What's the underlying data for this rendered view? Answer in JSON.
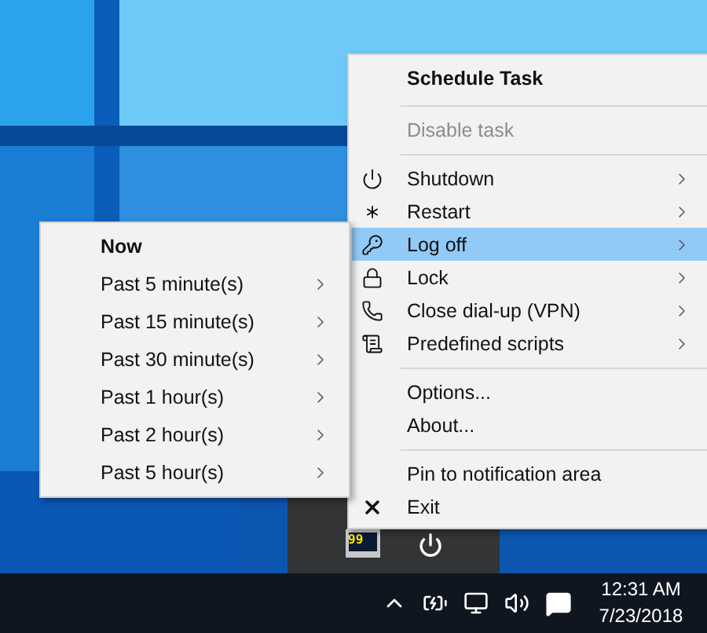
{
  "main_menu": {
    "items": [
      {
        "kind": "title",
        "label": "Schedule Task",
        "selected": false,
        "disabled": false,
        "submenu": false
      },
      {
        "kind": "separator"
      },
      {
        "kind": "item",
        "label": "Disable task",
        "selected": false,
        "disabled": true,
        "submenu": false
      },
      {
        "kind": "separator"
      },
      {
        "kind": "item",
        "label": "Shutdown",
        "selected": false,
        "disabled": false,
        "submenu": true
      },
      {
        "kind": "item",
        "label": "Restart",
        "selected": false,
        "disabled": false,
        "submenu": true
      },
      {
        "kind": "item",
        "label": "Log off",
        "selected": true,
        "disabled": false,
        "submenu": true
      },
      {
        "kind": "item",
        "label": "Lock",
        "selected": false,
        "disabled": false,
        "submenu": true
      },
      {
        "kind": "item",
        "label": "Close dial-up (VPN)",
        "selected": false,
        "disabled": false,
        "submenu": true
      },
      {
        "kind": "item",
        "label": "Predefined scripts",
        "selected": false,
        "disabled": false,
        "submenu": true
      },
      {
        "kind": "separator"
      },
      {
        "kind": "item",
        "label": "Options...",
        "selected": false,
        "disabled": false,
        "submenu": false
      },
      {
        "kind": "item",
        "label": "About...",
        "selected": false,
        "disabled": false,
        "submenu": false
      },
      {
        "kind": "separator"
      },
      {
        "kind": "item",
        "label": "Pin to notification area",
        "selected": false,
        "disabled": false,
        "submenu": false
      },
      {
        "kind": "item",
        "label": "Exit",
        "selected": false,
        "disabled": false,
        "submenu": false
      }
    ]
  },
  "submenu": {
    "items": [
      {
        "kind": "title",
        "label": "Now",
        "selected": false,
        "submenu": false
      },
      {
        "kind": "item",
        "label": "Past 5 minute(s)",
        "selected": false,
        "submenu": true
      },
      {
        "kind": "item",
        "label": "Past 15 minute(s)",
        "selected": false,
        "submenu": true
      },
      {
        "kind": "item",
        "label": "Past 30 minute(s)",
        "selected": false,
        "submenu": true
      },
      {
        "kind": "item",
        "label": "Past 1 hour(s)",
        "selected": false,
        "submenu": true
      },
      {
        "kind": "item",
        "label": "Past 2 hour(s)",
        "selected": false,
        "submenu": true
      },
      {
        "kind": "item",
        "label": "Past 5 hour(s)",
        "selected": false,
        "submenu": true
      }
    ]
  },
  "tray_overflow": {
    "icons": [
      {
        "kind": "app",
        "text": "99"
      },
      {
        "kind": "power"
      }
    ]
  },
  "taskbar": {
    "clock": {
      "time": "12:31 AM",
      "date": "7/23/2018"
    }
  }
}
